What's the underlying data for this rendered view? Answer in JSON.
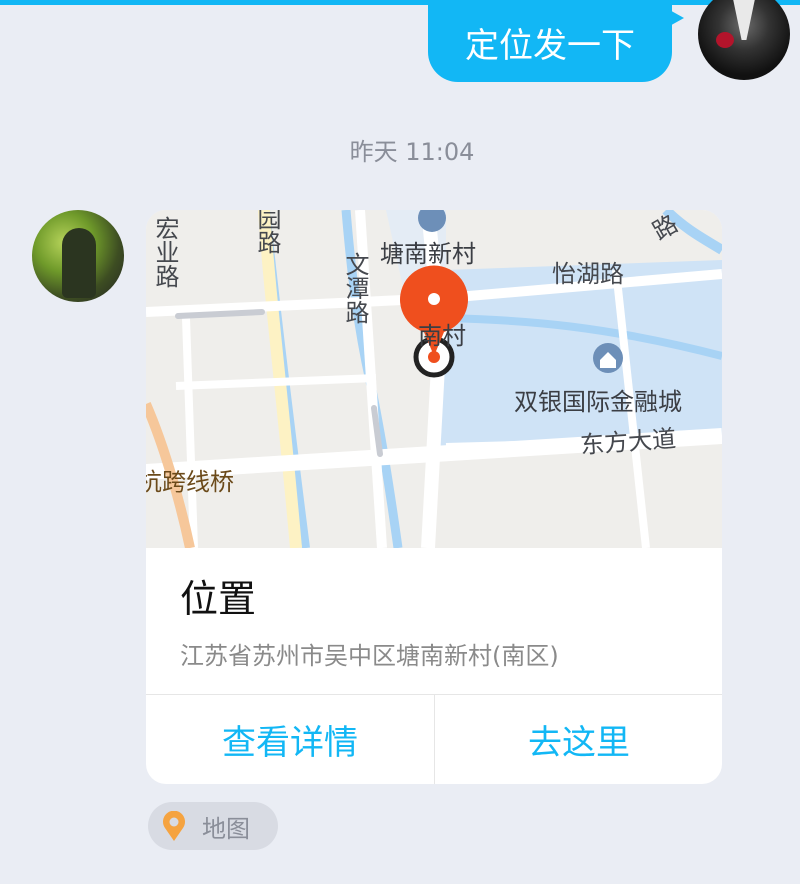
{
  "chat": {
    "sent_message": "定位发一下",
    "timestamp": "昨天 11:04"
  },
  "location_card": {
    "title": "位置",
    "address": "江苏省苏州市吴中区塘南新村(南区)",
    "view_details_label": "查看详情",
    "go_here_label": "去这里",
    "map_labels": {
      "hongye_road": "宏业路",
      "yuan_road": "园路",
      "wentan_road": "文潭路",
      "tangnan_village": "塘南新村",
      "nan_village": "南村",
      "yihu_road": "怡湖路",
      "shuangyin": "双银国际金融城",
      "dongfang_avenue": "东方大道",
      "bridge": "杭跨线桥",
      "road_fragment": "路"
    },
    "pin_color": "#ef4f1e"
  },
  "source_tag": {
    "label": "地图",
    "icon": "map-pin-icon"
  },
  "colors": {
    "accent": "#12b7f5",
    "background": "#eaedf4"
  }
}
